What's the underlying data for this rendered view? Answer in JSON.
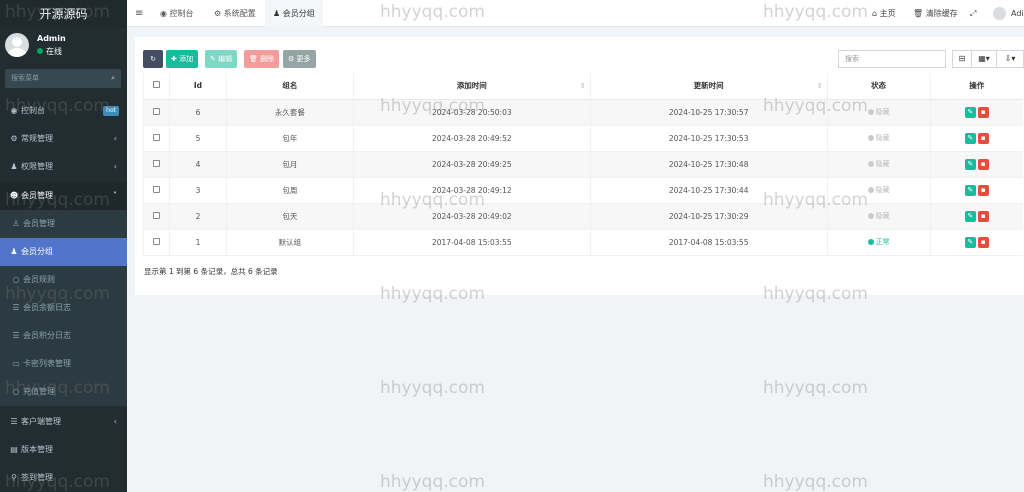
{
  "sidebar": {
    "logo": "开源源码",
    "user": {
      "name": "Admin",
      "status": "在线"
    },
    "search_placeholder": "搜索菜单",
    "items": [
      {
        "label": "控制台",
        "badge": "hot"
      },
      {
        "label": "常规管理"
      },
      {
        "label": "权限管理"
      },
      {
        "label": "会员管理"
      },
      {
        "label": "会员管理"
      },
      {
        "label": "会员分组"
      },
      {
        "label": "会员规则"
      },
      {
        "label": "会员余额日志"
      },
      {
        "label": "会员积分日志"
      },
      {
        "label": "卡密列表管理"
      },
      {
        "label": "充值管理"
      },
      {
        "label": "客户端管理"
      },
      {
        "label": "版本管理"
      },
      {
        "label": "签到管理"
      }
    ]
  },
  "header": {
    "tabs": [
      {
        "label": "控制台"
      },
      {
        "label": "系统配置"
      },
      {
        "label": "会员分组"
      }
    ],
    "home": "主页",
    "clear_cache": "清除缓存",
    "user": "Adi"
  },
  "toolbar": {
    "add": "添加",
    "edit": "编辑",
    "delete": "删除",
    "more": "更多",
    "search_placeholder": "搜索"
  },
  "table": {
    "columns": [
      "Id",
      "组名",
      "添加时间",
      "更新时间",
      "状态",
      "操作"
    ],
    "rows": [
      {
        "id": "6",
        "name": "永久套餐",
        "created": "2024-03-28 20:50:03",
        "updated": "2024-10-25 17:30:57",
        "status": "隐藏"
      },
      {
        "id": "5",
        "name": "包年",
        "created": "2024-03-28 20:49:52",
        "updated": "2024-10-25 17:30:53",
        "status": "隐藏"
      },
      {
        "id": "4",
        "name": "包月",
        "created": "2024-03-28 20:49:25",
        "updated": "2024-10-25 17:30:48",
        "status": "隐藏"
      },
      {
        "id": "3",
        "name": "包周",
        "created": "2024-03-28 20:49:12",
        "updated": "2024-10-25 17:30:44",
        "status": "隐藏"
      },
      {
        "id": "2",
        "name": "包天",
        "created": "2024-03-28 20:49:02",
        "updated": "2024-10-25 17:30:29",
        "status": "隐藏"
      },
      {
        "id": "1",
        "name": "默认组",
        "created": "2017-04-08 15:03:55",
        "updated": "2017-04-08 15:03:55",
        "status": "正常"
      }
    ]
  },
  "pager": "显示第 1 到第 6 条记录，总共 6 条记录",
  "watermark": "hhyyqq.com",
  "colors": {
    "sidebar": "#222d32",
    "active": "#5176c9",
    "add": "#18bc9c",
    "edit": "#7fd7c5",
    "delete": "#f39c9c",
    "more": "#95a5a6",
    "refresh": "#444e63",
    "danger": "#e74c3c"
  }
}
